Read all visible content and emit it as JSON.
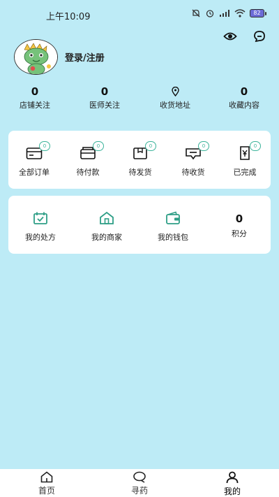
{
  "status_bar": {
    "time": "上午10:09",
    "battery": "82"
  },
  "profile": {
    "login_text": "登录/注册"
  },
  "stats": [
    {
      "value": "0",
      "label": "店铺关注"
    },
    {
      "value": "0",
      "label": "医师关注"
    },
    {
      "icon": "location-pin-icon",
      "label": "收货地址"
    },
    {
      "value": "0",
      "label": "收藏内容"
    }
  ],
  "orders": [
    {
      "label": "全部订单",
      "badge": "0",
      "icon": "wallet-card-icon"
    },
    {
      "label": "待付款",
      "badge": "0",
      "icon": "card-icon"
    },
    {
      "label": "待发货",
      "badge": "0",
      "icon": "package-icon"
    },
    {
      "label": "待收货",
      "badge": "0",
      "icon": "delivery-icon"
    },
    {
      "label": "已完成",
      "badge": "0",
      "icon": "completed-icon"
    }
  ],
  "services": [
    {
      "label": "我的处方",
      "icon": "prescription-calendar-icon"
    },
    {
      "label": "我的商家",
      "icon": "home-store-icon"
    },
    {
      "label": "我的钱包",
      "icon": "wallet-icon"
    },
    {
      "label": "积分",
      "value": "0"
    }
  ],
  "tabs": [
    {
      "label": "首页",
      "icon": "home-icon"
    },
    {
      "label": "寻药",
      "icon": "search-chat-icon"
    },
    {
      "label": "我的",
      "icon": "profile-icon"
    }
  ],
  "colors": {
    "background": "#bdebf6",
    "accent": "#3bb39a",
    "card": "#ffffff"
  }
}
